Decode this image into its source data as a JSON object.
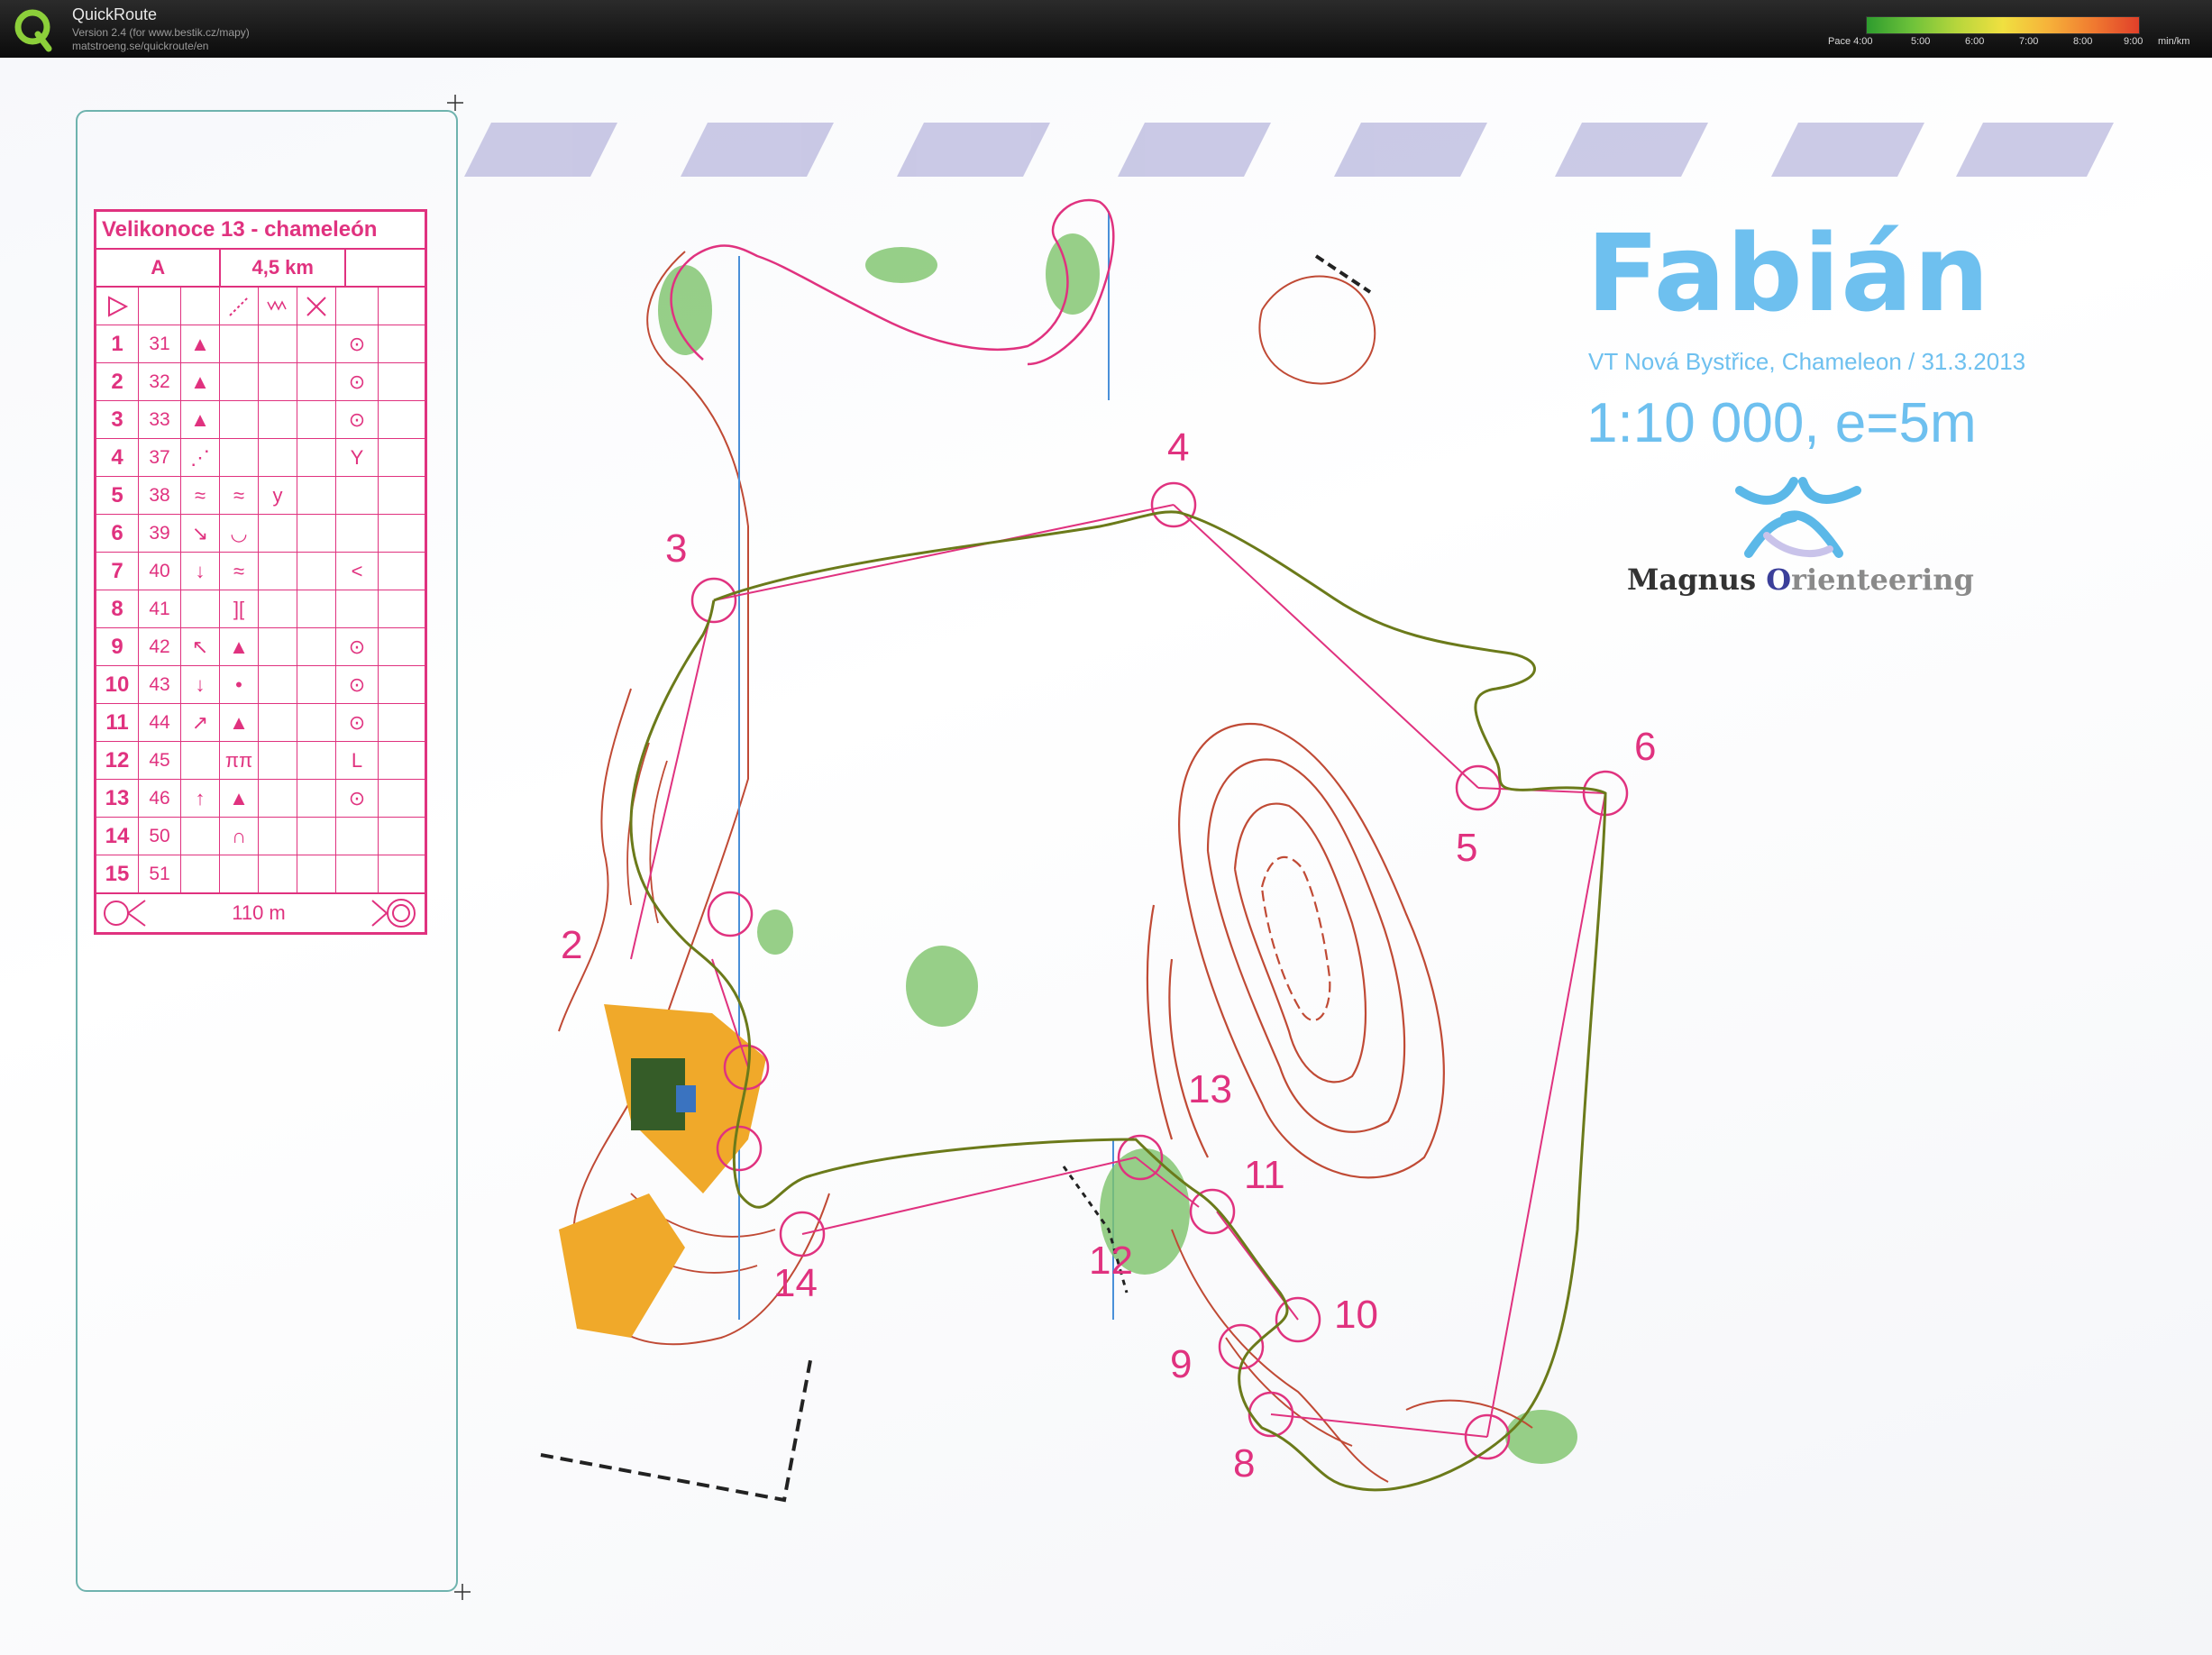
{
  "app": {
    "title": "QuickRoute",
    "version": "Version 2.4  (for www.bestik.cz/mapy)",
    "link": "matstroeng.se/quickroute/en",
    "pace_scale": {
      "label": "Pace 4:00",
      "ticks": [
        "5:00",
        "6:00",
        "7:00",
        "8:00",
        "9:00"
      ],
      "unit": "min/km",
      "colors": [
        "#2e9c2e",
        "#6ec23a",
        "#b8d63c",
        "#f0e040",
        "#f6b23a",
        "#f07a30",
        "#e0402a"
      ]
    }
  },
  "map": {
    "title": "Fabián",
    "event": "VT Nová Bystřice, Chameleon / 31.3.2013",
    "scale": "1:10 000, e=5m",
    "brand": {
      "first": "Magnus ",
      "o": "O",
      "rest": "rienteering"
    },
    "course_color": "#e0327f",
    "route_color": "#6b7a1a",
    "controls": [
      "3",
      "4",
      "5",
      "6",
      "13",
      "11",
      "12",
      "10",
      "9",
      "8",
      "14",
      "2"
    ]
  },
  "description": {
    "title": "Velikonoce 13 - chameleón",
    "class": "A",
    "length": "4,5 km",
    "rows": [
      {
        "n": "1",
        "code": "31",
        "what": "▲",
        "where": "",
        "extra": "",
        "detail": "",
        "appear": "⊙"
      },
      {
        "n": "2",
        "code": "32",
        "what": "▲",
        "where": "",
        "extra": "",
        "detail": "",
        "appear": "⊙"
      },
      {
        "n": "3",
        "code": "33",
        "what": "▲",
        "where": "",
        "extra": "",
        "detail": "",
        "appear": "⊙"
      },
      {
        "n": "4",
        "code": "37",
        "what": "⋰",
        "where": "",
        "extra": "",
        "detail": "",
        "appear": "Y"
      },
      {
        "n": "5",
        "code": "38",
        "what": "≈",
        "where": "≈",
        "extra": "y",
        "detail": "",
        "appear": ""
      },
      {
        "n": "6",
        "code": "39",
        "what": "↘",
        "where": "◡",
        "extra": "",
        "detail": "",
        "appear": ""
      },
      {
        "n": "7",
        "code": "40",
        "what": "↓",
        "where": "≈",
        "extra": "",
        "detail": "",
        "appear": "<"
      },
      {
        "n": "8",
        "code": "41",
        "what": "",
        "where": "][",
        "extra": "",
        "detail": "",
        "appear": ""
      },
      {
        "n": "9",
        "code": "42",
        "what": "↖",
        "where": "▲",
        "extra": "",
        "detail": "",
        "appear": "⊙"
      },
      {
        "n": "10",
        "code": "43",
        "what": "↓",
        "where": "•",
        "extra": "",
        "detail": "",
        "appear": "⊙"
      },
      {
        "n": "11",
        "code": "44",
        "what": "↗",
        "where": "▲",
        "extra": "",
        "detail": "",
        "appear": "⊙"
      },
      {
        "n": "12",
        "code": "45",
        "what": "",
        "where": "ππ",
        "extra": "",
        "detail": "",
        "appear": "L"
      },
      {
        "n": "13",
        "code": "46",
        "what": "↑",
        "where": "▲",
        "extra": "",
        "detail": "",
        "appear": "⊙"
      },
      {
        "n": "14",
        "code": "50",
        "what": "",
        "where": "∩",
        "extra": "",
        "detail": "",
        "appear": ""
      },
      {
        "n": "15",
        "code": "51",
        "what": "",
        "where": "",
        "extra": "",
        "detail": "",
        "appear": ""
      }
    ],
    "finish_distance": "110 m"
  }
}
